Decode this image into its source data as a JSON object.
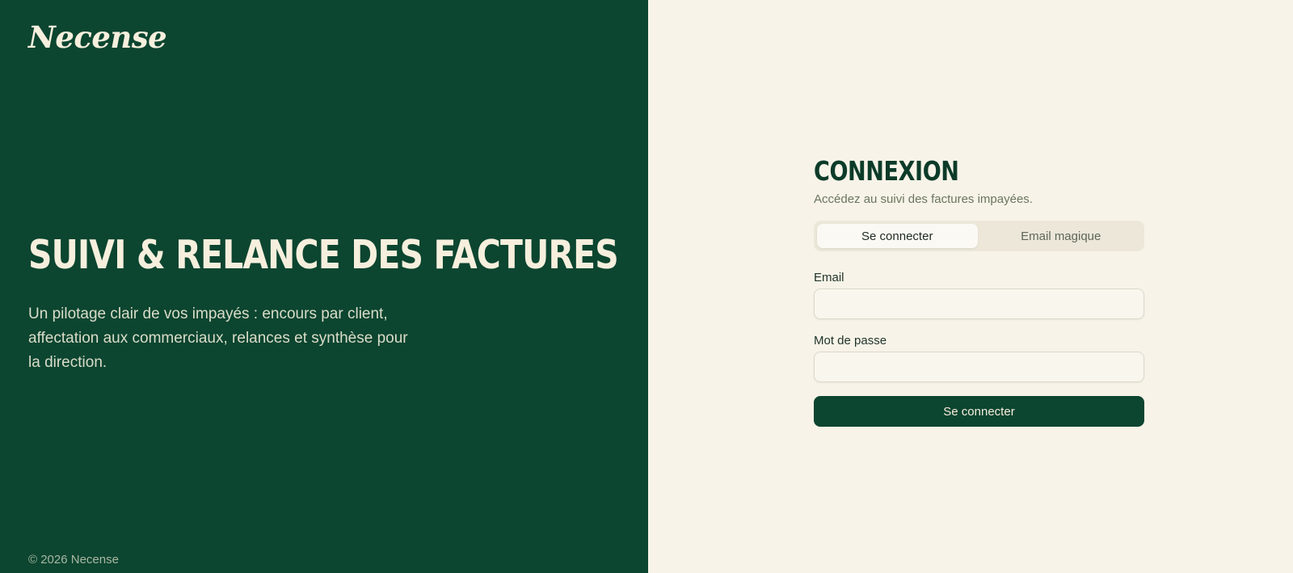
{
  "brand": {
    "logo_text": "Necense"
  },
  "hero": {
    "title": "SUIVI & RELANCE DES FACTURES",
    "subtitle": "Un pilotage clair de vos impayés : encours par client, affectation aux commerciaux, relances et synthèse pour la direction."
  },
  "footer": {
    "copyright": "© 2026 Necense"
  },
  "login": {
    "title": "CONNEXION",
    "subtitle": "Accédez au suivi des factures impayées.",
    "tabs": [
      {
        "label": "Se connecter",
        "active": true
      },
      {
        "label": "Email magique",
        "active": false
      }
    ],
    "email_label": "Email",
    "email_value": "",
    "email_placeholder": "",
    "password_label": "Mot de passe",
    "password_value": "",
    "password_placeholder": "",
    "submit_label": "Se connecter"
  },
  "colors": {
    "brand_green": "#0c4530",
    "cream_background": "#f7f3e8",
    "cream_text": "#f6efdd"
  }
}
